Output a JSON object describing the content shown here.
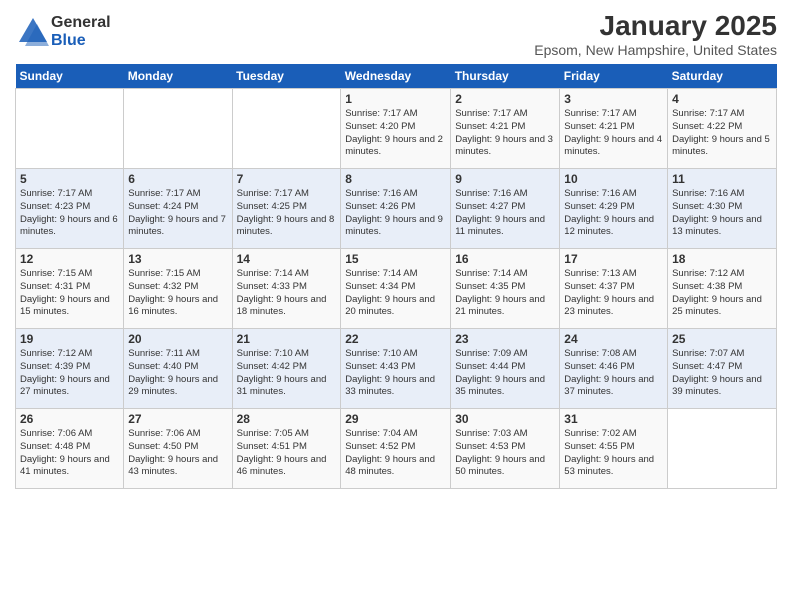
{
  "logo": {
    "general": "General",
    "blue": "Blue"
  },
  "title": "January 2025",
  "subtitle": "Epsom, New Hampshire, United States",
  "days_of_week": [
    "Sunday",
    "Monday",
    "Tuesday",
    "Wednesday",
    "Thursday",
    "Friday",
    "Saturday"
  ],
  "weeks": [
    [
      {
        "day": "",
        "info": ""
      },
      {
        "day": "",
        "info": ""
      },
      {
        "day": "",
        "info": ""
      },
      {
        "day": "1",
        "info": "Sunrise: 7:17 AM\nSunset: 4:20 PM\nDaylight: 9 hours and 2 minutes."
      },
      {
        "day": "2",
        "info": "Sunrise: 7:17 AM\nSunset: 4:21 PM\nDaylight: 9 hours and 3 minutes."
      },
      {
        "day": "3",
        "info": "Sunrise: 7:17 AM\nSunset: 4:21 PM\nDaylight: 9 hours and 4 minutes."
      },
      {
        "day": "4",
        "info": "Sunrise: 7:17 AM\nSunset: 4:22 PM\nDaylight: 9 hours and 5 minutes."
      }
    ],
    [
      {
        "day": "5",
        "info": "Sunrise: 7:17 AM\nSunset: 4:23 PM\nDaylight: 9 hours and 6 minutes."
      },
      {
        "day": "6",
        "info": "Sunrise: 7:17 AM\nSunset: 4:24 PM\nDaylight: 9 hours and 7 minutes."
      },
      {
        "day": "7",
        "info": "Sunrise: 7:17 AM\nSunset: 4:25 PM\nDaylight: 9 hours and 8 minutes."
      },
      {
        "day": "8",
        "info": "Sunrise: 7:16 AM\nSunset: 4:26 PM\nDaylight: 9 hours and 9 minutes."
      },
      {
        "day": "9",
        "info": "Sunrise: 7:16 AM\nSunset: 4:27 PM\nDaylight: 9 hours and 11 minutes."
      },
      {
        "day": "10",
        "info": "Sunrise: 7:16 AM\nSunset: 4:29 PM\nDaylight: 9 hours and 12 minutes."
      },
      {
        "day": "11",
        "info": "Sunrise: 7:16 AM\nSunset: 4:30 PM\nDaylight: 9 hours and 13 minutes."
      }
    ],
    [
      {
        "day": "12",
        "info": "Sunrise: 7:15 AM\nSunset: 4:31 PM\nDaylight: 9 hours and 15 minutes."
      },
      {
        "day": "13",
        "info": "Sunrise: 7:15 AM\nSunset: 4:32 PM\nDaylight: 9 hours and 16 minutes."
      },
      {
        "day": "14",
        "info": "Sunrise: 7:14 AM\nSunset: 4:33 PM\nDaylight: 9 hours and 18 minutes."
      },
      {
        "day": "15",
        "info": "Sunrise: 7:14 AM\nSunset: 4:34 PM\nDaylight: 9 hours and 20 minutes."
      },
      {
        "day": "16",
        "info": "Sunrise: 7:14 AM\nSunset: 4:35 PM\nDaylight: 9 hours and 21 minutes."
      },
      {
        "day": "17",
        "info": "Sunrise: 7:13 AM\nSunset: 4:37 PM\nDaylight: 9 hours and 23 minutes."
      },
      {
        "day": "18",
        "info": "Sunrise: 7:12 AM\nSunset: 4:38 PM\nDaylight: 9 hours and 25 minutes."
      }
    ],
    [
      {
        "day": "19",
        "info": "Sunrise: 7:12 AM\nSunset: 4:39 PM\nDaylight: 9 hours and 27 minutes."
      },
      {
        "day": "20",
        "info": "Sunrise: 7:11 AM\nSunset: 4:40 PM\nDaylight: 9 hours and 29 minutes."
      },
      {
        "day": "21",
        "info": "Sunrise: 7:10 AM\nSunset: 4:42 PM\nDaylight: 9 hours and 31 minutes."
      },
      {
        "day": "22",
        "info": "Sunrise: 7:10 AM\nSunset: 4:43 PM\nDaylight: 9 hours and 33 minutes."
      },
      {
        "day": "23",
        "info": "Sunrise: 7:09 AM\nSunset: 4:44 PM\nDaylight: 9 hours and 35 minutes."
      },
      {
        "day": "24",
        "info": "Sunrise: 7:08 AM\nSunset: 4:46 PM\nDaylight: 9 hours and 37 minutes."
      },
      {
        "day": "25",
        "info": "Sunrise: 7:07 AM\nSunset: 4:47 PM\nDaylight: 9 hours and 39 minutes."
      }
    ],
    [
      {
        "day": "26",
        "info": "Sunrise: 7:06 AM\nSunset: 4:48 PM\nDaylight: 9 hours and 41 minutes."
      },
      {
        "day": "27",
        "info": "Sunrise: 7:06 AM\nSunset: 4:50 PM\nDaylight: 9 hours and 43 minutes."
      },
      {
        "day": "28",
        "info": "Sunrise: 7:05 AM\nSunset: 4:51 PM\nDaylight: 9 hours and 46 minutes."
      },
      {
        "day": "29",
        "info": "Sunrise: 7:04 AM\nSunset: 4:52 PM\nDaylight: 9 hours and 48 minutes."
      },
      {
        "day": "30",
        "info": "Sunrise: 7:03 AM\nSunset: 4:53 PM\nDaylight: 9 hours and 50 minutes."
      },
      {
        "day": "31",
        "info": "Sunrise: 7:02 AM\nSunset: 4:55 PM\nDaylight: 9 hours and 53 minutes."
      },
      {
        "day": "",
        "info": ""
      }
    ]
  ]
}
